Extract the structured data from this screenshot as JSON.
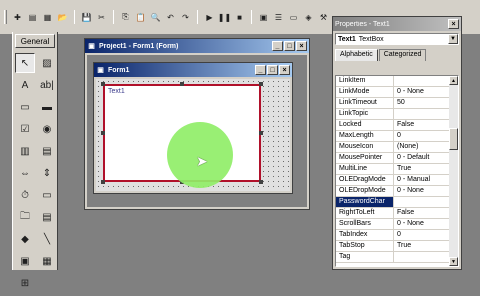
{
  "toolbar": {
    "buttons": [
      {
        "icon": "grip",
        "name": "toolbar-grip"
      },
      {
        "icon": "✚",
        "name": "add-project-icon"
      },
      {
        "icon": "▤",
        "name": "add-form-icon"
      },
      {
        "icon": "▦",
        "name": "menu-editor-icon"
      },
      {
        "icon": "📂",
        "name": "open-project-icon"
      },
      {
        "icon": "💾",
        "name": "save-project-icon"
      },
      {
        "icon": "✂",
        "name": "cut-icon"
      },
      {
        "icon": "⎘",
        "name": "copy-icon"
      },
      {
        "icon": "📋",
        "name": "paste-icon"
      },
      {
        "icon": "🔍",
        "name": "find-icon"
      },
      {
        "icon": "↶",
        "name": "undo-icon"
      },
      {
        "icon": "↷",
        "name": "redo-icon"
      },
      {
        "icon": "▶",
        "name": "start-icon"
      },
      {
        "icon": "❚❚",
        "name": "break-icon"
      },
      {
        "icon": "■",
        "name": "end-icon"
      },
      {
        "icon": "▣",
        "name": "project-explorer-icon"
      },
      {
        "icon": "☰",
        "name": "properties-window-icon"
      },
      {
        "icon": "▭",
        "name": "form-layout-icon"
      },
      {
        "icon": "◈",
        "name": "object-browser-icon"
      },
      {
        "icon": "⚒",
        "name": "toolbox-icon"
      }
    ]
  },
  "toolbox": {
    "title": "General",
    "tools": [
      {
        "icon": "↖",
        "name": "pointer-tool-icon",
        "active": true
      },
      {
        "icon": "▨",
        "name": "picturebox-tool-icon"
      },
      {
        "icon": "A",
        "name": "label-tool-icon"
      },
      {
        "icon": "ab|",
        "name": "textbox-tool-icon"
      },
      {
        "icon": "▭",
        "name": "frame-tool-icon"
      },
      {
        "icon": "▬",
        "name": "commandbutton-tool-icon"
      },
      {
        "icon": "☑",
        "name": "checkbox-tool-icon"
      },
      {
        "icon": "◉",
        "name": "optionbutton-tool-icon"
      },
      {
        "icon": "▥",
        "name": "combobox-tool-icon"
      },
      {
        "icon": "▤",
        "name": "listbox-tool-icon"
      },
      {
        "icon": "⇔",
        "name": "hscrollbar-tool-icon"
      },
      {
        "icon": "⇕",
        "name": "vscrollbar-tool-icon"
      },
      {
        "icon": "⏱",
        "name": "timer-tool-icon"
      },
      {
        "icon": "▭",
        "name": "drivelistbox-tool-icon"
      },
      {
        "icon": "🗀",
        "name": "dirlistbox-tool-icon"
      },
      {
        "icon": "▤",
        "name": "filelistbox-tool-icon"
      },
      {
        "icon": "◆",
        "name": "shape-tool-icon"
      },
      {
        "icon": "╲",
        "name": "line-tool-icon"
      },
      {
        "icon": "▣",
        "name": "image-tool-icon"
      },
      {
        "icon": "▦",
        "name": "data-tool-icon"
      },
      {
        "icon": "⊞",
        "name": "ole-tool-icon"
      }
    ]
  },
  "project_window": {
    "title": "Project1 - Form1 (Form)",
    "min": "_",
    "max": "□",
    "close": "×"
  },
  "form1": {
    "title": "Form1",
    "min": "_",
    "max": "□",
    "close": "×",
    "textbox_text": "Text1"
  },
  "properties": {
    "title": "Properties - Text1",
    "close": "×",
    "object_name": "Text1",
    "object_type": "TextBox",
    "tabs": [
      "Alphabetic",
      "Categorized"
    ],
    "rows": [
      {
        "name": "LinkItem",
        "value": ""
      },
      {
        "name": "LinkMode",
        "value": "0 - None"
      },
      {
        "name": "LinkTimeout",
        "value": "50"
      },
      {
        "name": "LinkTopic",
        "value": ""
      },
      {
        "name": "Locked",
        "value": "False"
      },
      {
        "name": "MaxLength",
        "value": "0"
      },
      {
        "name": "MouseIcon",
        "value": "(None)"
      },
      {
        "name": "MousePointer",
        "value": "0 - Default"
      },
      {
        "name": "MultiLine",
        "value": "True"
      },
      {
        "name": "OLEDragMode",
        "value": "0 - Manual"
      },
      {
        "name": "OLEDropMode",
        "value": "0 - None"
      },
      {
        "name": "PasswordChar",
        "value": "",
        "selected": true
      },
      {
        "name": "RightToLeft",
        "value": "False"
      },
      {
        "name": "ScrollBars",
        "value": "0 - None"
      },
      {
        "name": "TabIndex",
        "value": "0"
      },
      {
        "name": "TabStop",
        "value": "True"
      },
      {
        "name": "Tag",
        "value": ""
      }
    ]
  },
  "colors": {
    "active_title": "#0a246a",
    "selection_border": "#b0102a",
    "cursor_highlight": "#90ee68"
  }
}
